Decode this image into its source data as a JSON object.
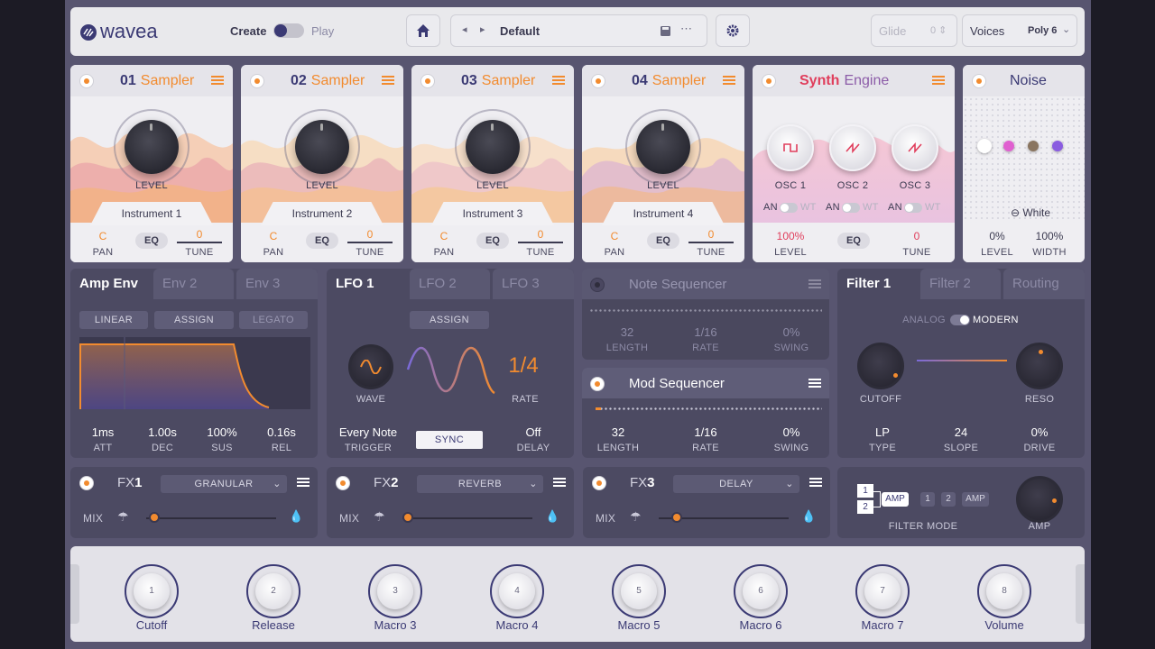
{
  "topbar": {
    "brand": "wavea",
    "create": "Create",
    "play": "Play",
    "preset": "Default",
    "glide": "Glide",
    "glide_val": "0 ⇕",
    "voices": "Voices",
    "voices_val": "Poly 6"
  },
  "samplers": [
    {
      "num": "01",
      "name": "Sampler",
      "level": "LEVEL",
      "instrument": "Instrument 1",
      "pan_val": "C",
      "pan": "PAN",
      "eq": "EQ",
      "tune_val": "0",
      "tune": "TUNE"
    },
    {
      "num": "02",
      "name": "Sampler",
      "level": "LEVEL",
      "instrument": "Instrument 2",
      "pan_val": "C",
      "pan": "PAN",
      "eq": "EQ",
      "tune_val": "0",
      "tune": "TUNE"
    },
    {
      "num": "03",
      "name": "Sampler",
      "level": "LEVEL",
      "instrument": "Instrument 3",
      "pan_val": "C",
      "pan": "PAN",
      "eq": "EQ",
      "tune_val": "0",
      "tune": "TUNE"
    },
    {
      "num": "04",
      "name": "Sampler",
      "level": "LEVEL",
      "instrument": "Instrument 4",
      "pan_val": "C",
      "pan": "PAN",
      "eq": "EQ",
      "tune_val": "0",
      "tune": "TUNE"
    }
  ],
  "synth": {
    "title_a": "Synth",
    "title_b": "Engine",
    "osc1": "OSC 1",
    "osc2": "OSC 2",
    "osc3": "OSC 3",
    "an": "AN",
    "wt": "WT",
    "level_val": "100%",
    "level": "LEVEL",
    "eq": "EQ",
    "tune_val": "0",
    "tune": "TUNE"
  },
  "noise": {
    "title": "Noise",
    "type": "White",
    "level_val": "0%",
    "level": "LEVEL",
    "width_val": "100%",
    "width": "WIDTH",
    "dot_colors": [
      "#ffffff",
      "#e060d0",
      "#8a7560",
      "#8a5ce0"
    ]
  },
  "env": {
    "tabs": [
      "Amp Env",
      "Env 2",
      "Env 3"
    ],
    "buttons": [
      "LINEAR",
      "ASSIGN",
      "LEGATO"
    ],
    "vals": [
      "1ms",
      "1.00s",
      "100%",
      "0.16s"
    ],
    "lbls": [
      "ATT",
      "DEC",
      "SUS",
      "REL"
    ],
    "level": {
      "attack": 0.01,
      "decay": 1.0,
      "sustain": 1.0,
      "release": 0.16
    }
  },
  "lfo": {
    "tabs": [
      "LFO 1",
      "LFO 2",
      "LFO 3"
    ],
    "assign": "ASSIGN",
    "wave": "WAVE",
    "rate_val": "1/4",
    "rate": "RATE",
    "trigger_val": "Every Note",
    "trigger": "TRIGGER",
    "sync": "SYNC",
    "delay_val": "Off",
    "delay": "DELAY"
  },
  "noteseq": {
    "title": "Note Sequencer",
    "length_val": "32",
    "length": "LENGTH",
    "rate_val": "1/16",
    "rate": "RATE",
    "swing_val": "0%",
    "swing": "SWING"
  },
  "modseq": {
    "title": "Mod Sequencer",
    "length_val": "32",
    "length": "LENGTH",
    "rate_val": "1/16",
    "rate": "RATE",
    "swing_val": "0%",
    "swing": "SWING"
  },
  "filter": {
    "tabs": [
      "Filter 1",
      "Filter 2",
      "Routing"
    ],
    "analog": "ANALOG",
    "modern": "MODERN",
    "cutoff": "CUTOFF",
    "reso": "RESO",
    "type_val": "LP",
    "type": "TYPE",
    "slope_val": "24",
    "slope": "SLOPE",
    "drive_val": "0%",
    "drive": "DRIVE"
  },
  "fx": [
    {
      "label": "FX",
      "num": "1",
      "effect": "GRANULAR",
      "mix": "MIX"
    },
    {
      "label": "FX",
      "num": "2",
      "effect": "REVERB",
      "mix": "MIX"
    },
    {
      "label": "FX",
      "num": "3",
      "effect": "DELAY",
      "mix": "MIX"
    }
  ],
  "filtermode": {
    "one": "1",
    "two": "2",
    "amp": "AMP",
    "ser_one": "1",
    "ser_two": "2",
    "ser_amp": "AMP",
    "label": "FILTER MODE",
    "amp_label": "AMP"
  },
  "macros": [
    {
      "n": "1",
      "label": "Cutoff"
    },
    {
      "n": "2",
      "label": "Release"
    },
    {
      "n": "3",
      "label": "Macro 3"
    },
    {
      "n": "4",
      "label": "Macro 4"
    },
    {
      "n": "5",
      "label": "Macro 5"
    },
    {
      "n": "6",
      "label": "Macro 6"
    },
    {
      "n": "7",
      "label": "Macro 7"
    },
    {
      "n": "8",
      "label": "Volume"
    }
  ],
  "colors": {
    "accent": "#f28b2f",
    "brand": "#3b3a74",
    "panel": "#4c4a62"
  }
}
